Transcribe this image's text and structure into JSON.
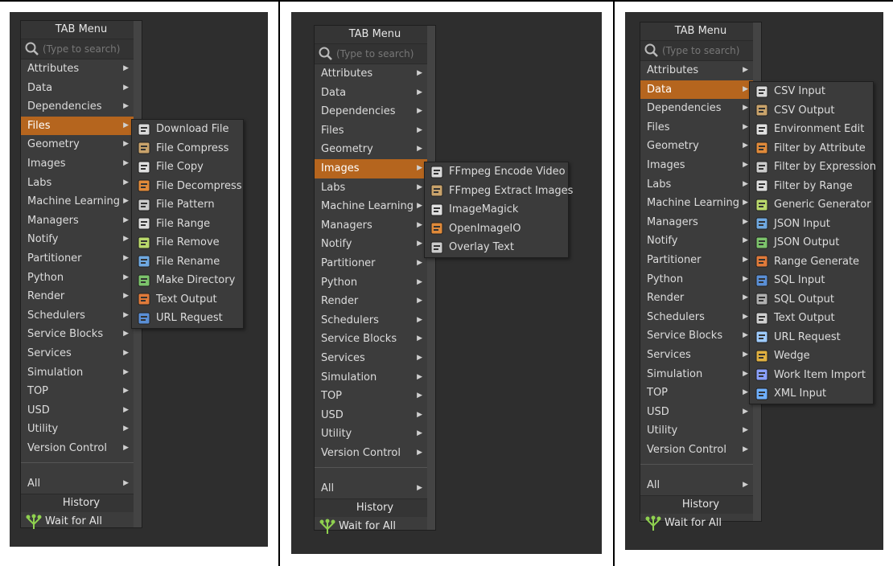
{
  "menu": {
    "title": "TAB Menu",
    "search_placeholder": "(Type to search)",
    "all_label": "All",
    "history_label": "History",
    "history_item": "Wait for All",
    "categories": [
      "Attributes",
      "Data",
      "Dependencies",
      "Files",
      "Geometry",
      "Images",
      "Labs",
      "Machine Learning",
      "Managers",
      "Notify",
      "Partitioner",
      "Python",
      "Render",
      "Schedulers",
      "Service Blocks",
      "Services",
      "Simulation",
      "TOP",
      "USD",
      "Utility",
      "Version Control"
    ]
  },
  "submenus": {
    "files": [
      "Download File",
      "File Compress",
      "File Copy",
      "File Decompress",
      "File Pattern",
      "File Range",
      "File Remove",
      "File Rename",
      "Make Directory",
      "Text Output",
      "URL Request"
    ],
    "images": [
      "FFmpeg Encode Video",
      "FFmpeg Extract Images",
      "ImageMagick",
      "OpenImageIO",
      "Overlay Text"
    ],
    "data": [
      "CSV Input",
      "CSV Output",
      "Environment Edit",
      "Filter by Attribute",
      "Filter by Expression",
      "Filter by Range",
      "Generic Generator",
      "JSON Input",
      "JSON Output",
      "Range Generate",
      "SQL Input",
      "SQL Output",
      "Text Output",
      "URL Request",
      "Wedge",
      "Work Item Import",
      "XML Input"
    ]
  },
  "highlighted": {
    "panel1": "Files",
    "panel2": "Images",
    "panel3": "Data"
  },
  "colors": {
    "highlight": "#b5651e",
    "menu_bg": "#3c3c3c",
    "panel_bg": "#2e2e2e"
  }
}
